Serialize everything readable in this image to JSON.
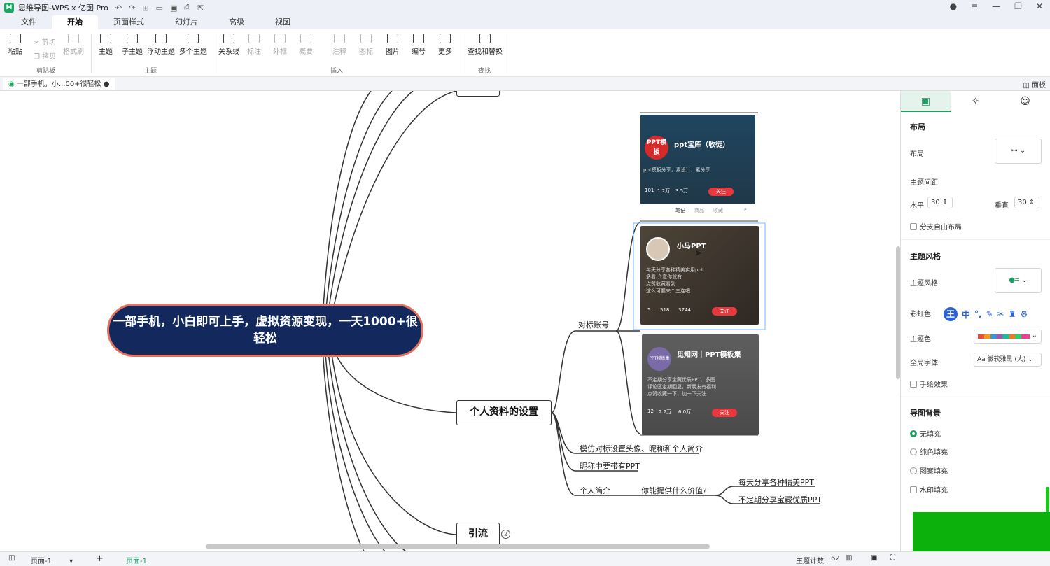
{
  "window": {
    "title": "思维导图-WPS x 亿图 Pro",
    "icon_label": "M"
  },
  "menu": {
    "tabs": [
      "文件",
      "开始",
      "页面样式",
      "幻灯片",
      "高级",
      "视图"
    ],
    "active": "开始"
  },
  "ribbon": {
    "paste": "粘贴",
    "cut": "剪切",
    "copy": "拷贝",
    "format_painter": "格式刷",
    "topic": "主题",
    "subtopic": "子主题",
    "floating_topic": "浮动主题",
    "multi_topic": "多个主题",
    "relation": "关系线",
    "callout": "标注",
    "frame": "外框",
    "summary": "概要",
    "note": "注释",
    "icon": "图标",
    "image": "图片",
    "numbering": "编号",
    "more": "更多",
    "find_replace": "查找和替换",
    "groups": {
      "clipboard": "剪贴板",
      "topic": "主题",
      "insert": "插入",
      "find": "查找"
    }
  },
  "doc_tab": {
    "title": "一部手机，小...00+很轻松"
  },
  "panel_toggle": "面板",
  "mindmap": {
    "root": "一部手机，小白即可上手，虚拟资源变现，一天1000+很轻松",
    "topic_profile": "个人资料的设置",
    "topic_traffic": "引流",
    "traffic_badge": "2",
    "benchmark": "对标账号",
    "imitate": "模仿对标设置头像、昵称和个人简介",
    "nickname": "昵称中要带有PPT",
    "bio": "个人简介",
    "value_q": "你能提供什么价值?",
    "value_a1": "每天分享各种精美PPT",
    "value_a2": "不定期分享宝藏优质PPT"
  },
  "phones": [
    {
      "name": "ppt宝库（收徒）",
      "avatar_text": "PPT模板",
      "desc": "ppt模板分享，素设计，素分享",
      "stats": [
        "101",
        "1.2万",
        "3.5万"
      ],
      "follow": "关注",
      "tabs": [
        "笔记",
        "商品",
        "收藏"
      ]
    },
    {
      "name": "小马PPT",
      "lines": [
        "每天分享各种精美实用ppt",
        "多看 介意你就有",
        "点赞收藏看到",
        "这么可要来个三连吧"
      ],
      "stats": [
        "5",
        "518",
        "3744"
      ],
      "follow": "关注"
    },
    {
      "name": "觅知网｜PPT模板集",
      "avatar_text": "PPT模板集",
      "lines": [
        "不定期分享宝藏优质PPT、多图",
        "评论区定期回复，新朋友有福利",
        "点赞收藏一下，加一下关注"
      ],
      "stats": [
        "12",
        "2.7万",
        "6.0万"
      ],
      "follow": "关注"
    }
  ],
  "panel": {
    "layout_section": "布局",
    "layout_label": "布局",
    "spacing_label": "主题间距",
    "horizontal": "水平",
    "horizontal_val": "30",
    "vertical": "垂直",
    "vertical_val": "30",
    "free_layout": "分支自由布局",
    "style_section": "主题风格",
    "style_label": "主题风格",
    "rainbow": "彩虹色",
    "theme_color": "主题色",
    "global_font": "全局字体",
    "font_value": "微软雅黑 (大)",
    "hand_drawn": "手绘效果",
    "bg_section": "导图背景",
    "bg_none": "无填充",
    "bg_solid": "纯色填充",
    "bg_pattern": "图案填充",
    "bg_watermark": "水印填充"
  },
  "ime": {
    "label": "王",
    "zh": "中"
  },
  "status": {
    "page_select": "页面-1",
    "page_tab": "页面-1",
    "topic_count_label": "主题计数:",
    "topic_count": "62"
  }
}
